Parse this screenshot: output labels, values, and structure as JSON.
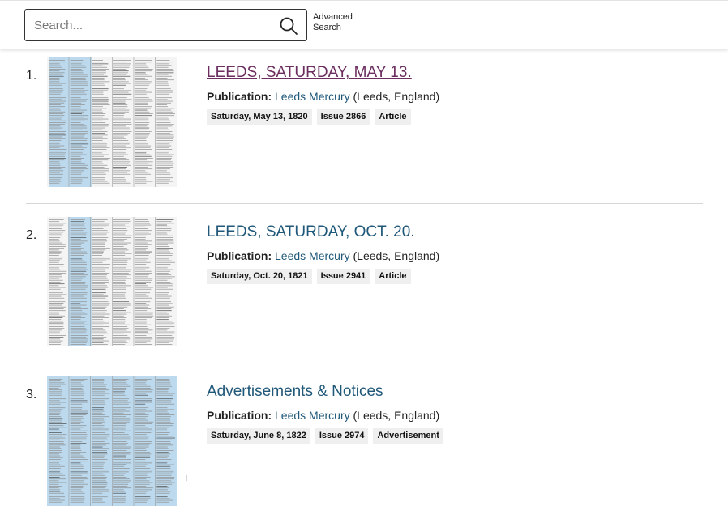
{
  "search": {
    "placeholder": "Search...",
    "advanced_label": "Advanced Search"
  },
  "results": [
    {
      "number": "1.",
      "title": "LEEDS, SATURDAY, MAY 13.",
      "visited": true,
      "publication_label": "Publication:",
      "publication_name": "Leeds Mercury",
      "publication_place": "(Leeds, England)",
      "tags": [
        "Saturday, May 13, 1820",
        "Issue 2866",
        "Article"
      ]
    },
    {
      "number": "2.",
      "title": "LEEDS, SATURDAY, OCT. 20.",
      "visited": false,
      "publication_label": "Publication:",
      "publication_name": "Leeds Mercury",
      "publication_place": "(Leeds, England)",
      "tags": [
        "Saturday, Oct. 20, 1821",
        "Issue 2941",
        "Article"
      ]
    },
    {
      "number": "3.",
      "title": "Advertisements & Notices",
      "visited": false,
      "publication_label": "Publication:",
      "publication_name": "Leeds Mercury",
      "publication_place": "(Leeds, England)",
      "tags": [
        "Saturday, June 8, 1822",
        "Issue 2974",
        "Advertisement"
      ]
    }
  ],
  "colors": {
    "link": "#20587a",
    "visited_link": "#6b2e5f",
    "highlight": "#bcd9ee"
  },
  "icons": {
    "search": "search-icon",
    "thumbnail": "newspaper-thumbnail"
  }
}
